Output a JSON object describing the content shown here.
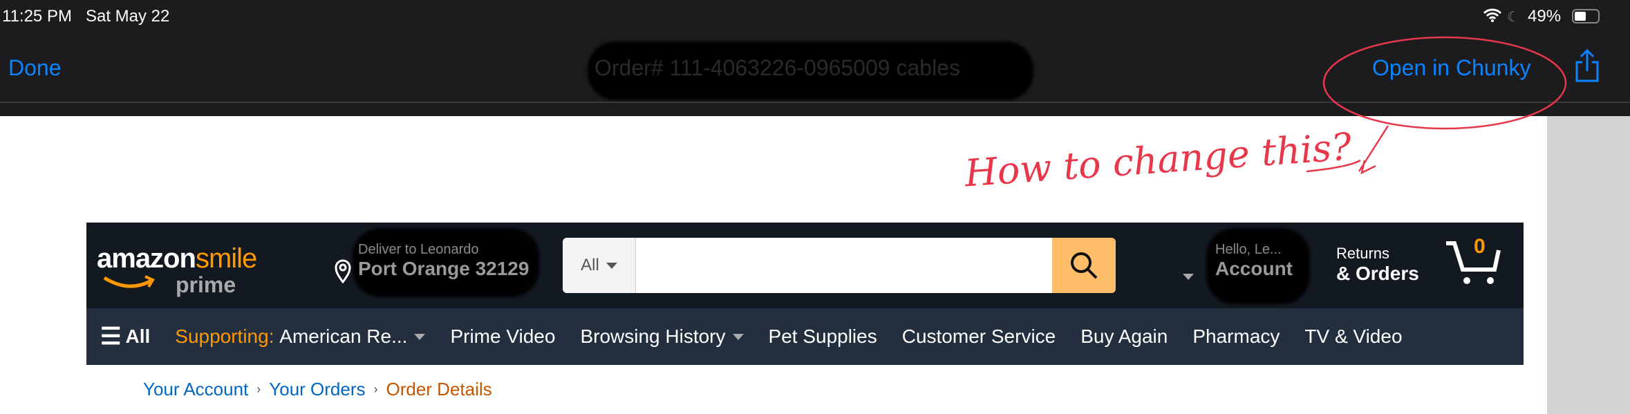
{
  "status_bar": {
    "time": "11:25 PM",
    "date": "Sat May 22",
    "battery": "49%"
  },
  "toolbar": {
    "done": "Done",
    "title": "Order# 111-4063226-0965009 cables",
    "open_in": "Open in Chunky"
  },
  "annotation": {
    "text": "How to change this?",
    "color": "#e8364a"
  },
  "amazon": {
    "logo_main": "amazon",
    "logo_smile": "smile",
    "logo_prime": "prime",
    "deliver_line1": "Deliver to Leonardo",
    "deliver_line2": "Port Orange 32129",
    "search_category": "All",
    "search_value": "",
    "account_line1": "Hello, Le...",
    "account_line2": "Account",
    "returns_line1": "Returns",
    "returns_line2": "& Orders",
    "cart_count": "0",
    "nav": {
      "all": "All",
      "supporting_label": "Supporting:",
      "supporting_value": "American Re...",
      "items": [
        "Prime Video",
        "Browsing History",
        "Pet Supplies",
        "Customer Service",
        "Buy Again",
        "Pharmacy",
        "TV & Video"
      ]
    },
    "breadcrumb": [
      "Your Account",
      "Your Orders",
      "Order Details"
    ]
  },
  "colors": {
    "accent": "#0a84ff",
    "amazon_orange": "#ff9900",
    "search_button": "#febd69",
    "link": "#0066c0",
    "current": "#c45500"
  }
}
